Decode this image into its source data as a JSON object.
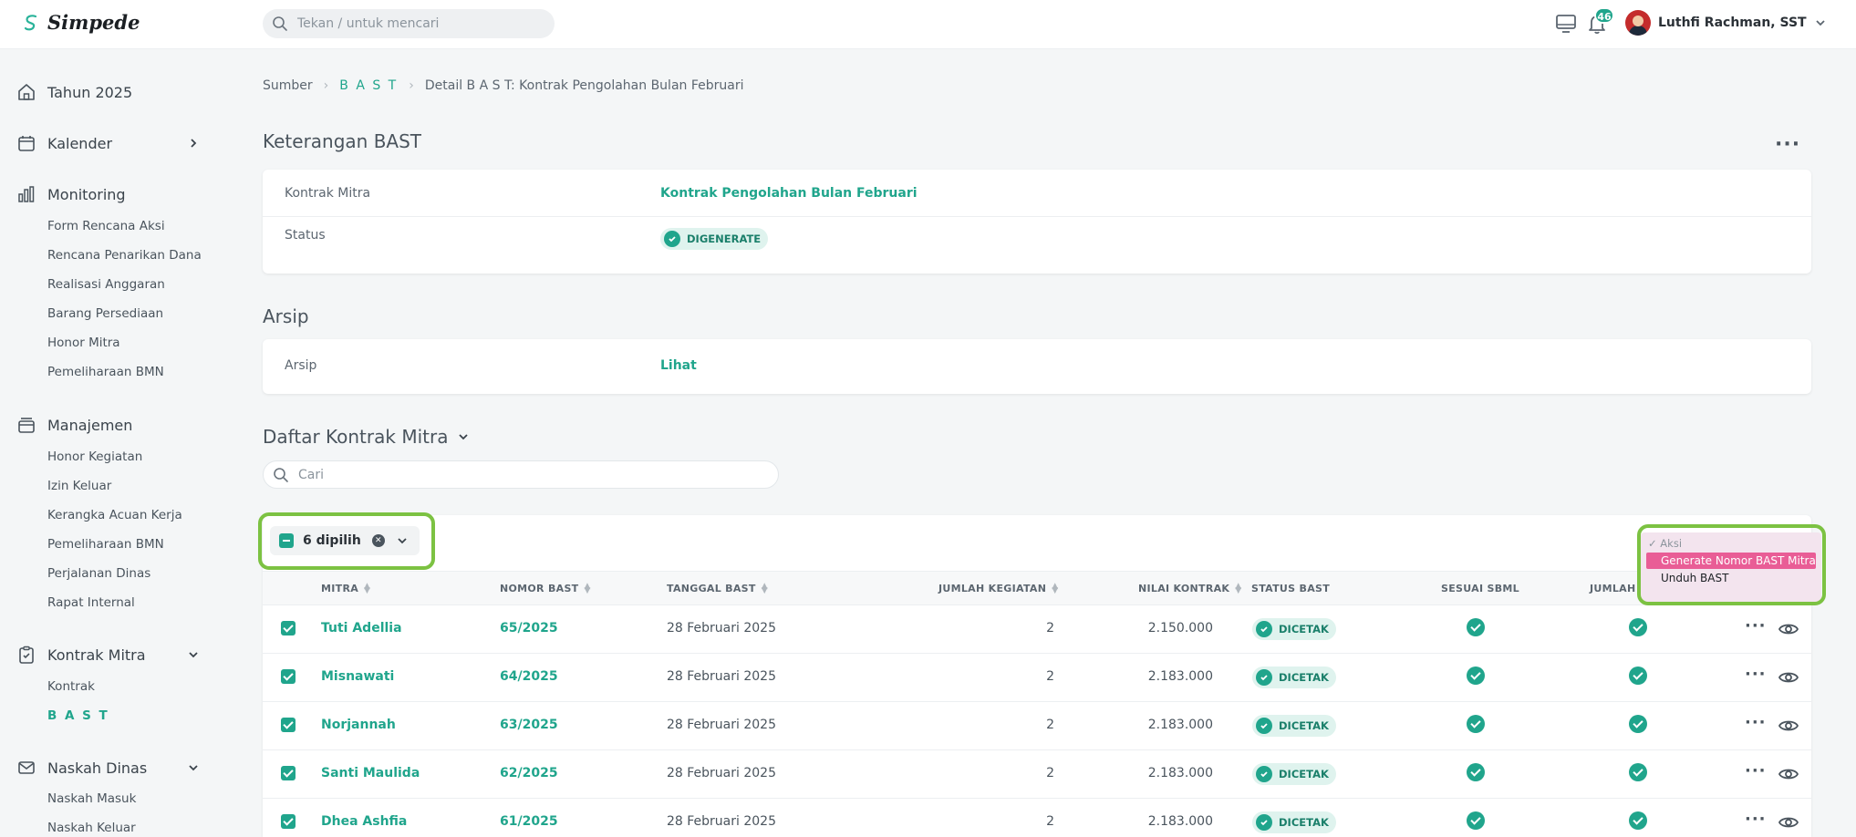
{
  "app": {
    "name": "Simpede",
    "search_placeholder": "Tekan / untuk mencari",
    "notification_count": "46",
    "user_name": "Luthfi Rachman, SST"
  },
  "sidebar": {
    "year": "Tahun 2025",
    "calendar": "Kalender",
    "monitoring": {
      "label": "Monitoring",
      "items": [
        "Form Rencana Aksi",
        "Rencana Penarikan Dana",
        "Realisasi Anggaran",
        "Barang Persediaan",
        "Honor Mitra",
        "Pemeliharaan BMN"
      ]
    },
    "manajemen": {
      "label": "Manajemen",
      "items": [
        "Honor Kegiatan",
        "Izin Keluar",
        "Kerangka Acuan Kerja",
        "Pemeliharaan BMN",
        "Perjalanan Dinas",
        "Rapat Internal"
      ]
    },
    "kontrak": {
      "label": "Kontrak Mitra",
      "items": [
        "Kontrak",
        "B A S T"
      ]
    },
    "naskah": {
      "label": "Naskah Dinas",
      "items": [
        "Naskah Masuk",
        "Naskah Keluar"
      ]
    }
  },
  "breadcrumb": {
    "root": "Sumber",
    "parent": "B A S T",
    "current": "Detail B A S T: Kontrak Pengolahan Bulan Februari"
  },
  "keterangan": {
    "title": "Keterangan BAST",
    "kontrak_label": "Kontrak Mitra",
    "kontrak_value": "Kontrak Pengolahan Bulan Februari",
    "status_label": "Status",
    "status_value": "DIGENERATE"
  },
  "arsip": {
    "title": "Arsip",
    "label": "Arsip",
    "value": "Lihat"
  },
  "daftar": {
    "title": "Daftar Kontrak Mitra",
    "search_placeholder": "Cari",
    "selected_label": "6 dipilih",
    "columns": {
      "mitra": "MITRA",
      "nomor": "NOMOR BAST",
      "tanggal": "TANGGAL BAST",
      "jumlah_kegiatan": "JUMLAH KEGIATAN",
      "nilai": "NILAI KONTRAK",
      "status": "STATUS BAST",
      "sbml": "SESUAI SBML",
      "jumlah_k": "JUMLAH K"
    },
    "rows": [
      {
        "mitra": "Tuti Adellia",
        "nomor": "65/2025",
        "tanggal": "28 Februari 2025",
        "jumlah": "2",
        "nilai": "2.150.000",
        "status": "DICETAK"
      },
      {
        "mitra": "Misnawati",
        "nomor": "64/2025",
        "tanggal": "28 Februari 2025",
        "jumlah": "2",
        "nilai": "2.183.000",
        "status": "DICETAK"
      },
      {
        "mitra": "Norjannah",
        "nomor": "63/2025",
        "tanggal": "28 Februari 2025",
        "jumlah": "2",
        "nilai": "2.183.000",
        "status": "DICETAK"
      },
      {
        "mitra": "Santi Maulida",
        "nomor": "62/2025",
        "tanggal": "28 Februari 2025",
        "jumlah": "2",
        "nilai": "2.183.000",
        "status": "DICETAK"
      },
      {
        "mitra": "Dhea Ashfia",
        "nomor": "61/2025",
        "tanggal": "28 Februari 2025",
        "jumlah": "2",
        "nilai": "2.183.000",
        "status": "DICETAK"
      }
    ]
  },
  "aksi_menu": {
    "header": "Aksi",
    "items": [
      "Generate Nomor BAST Mitra",
      "Unduh BAST"
    ]
  },
  "colors": {
    "accent": "#20a58c",
    "highlight": "#7cc242",
    "menu_active": "#e95d96"
  }
}
